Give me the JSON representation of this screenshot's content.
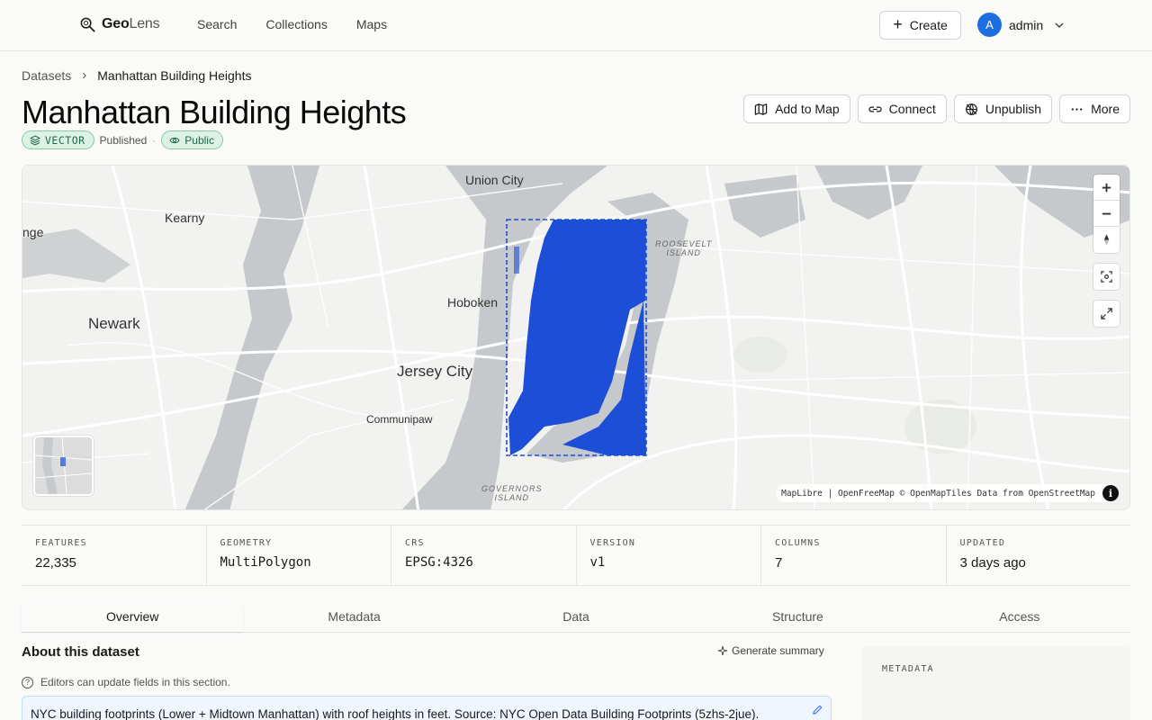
{
  "brand": {
    "name_bold": "Geo",
    "name_light": "Lens"
  },
  "nav": {
    "links": [
      "Search",
      "Collections",
      "Maps"
    ],
    "create_label": "Create",
    "user_initial": "A",
    "user_name": "admin"
  },
  "breadcrumb": {
    "parent": "Datasets",
    "current": "Manhattan Building Heights"
  },
  "dataset": {
    "title": "Manhattan Building Heights",
    "type_badge": "VECTOR",
    "status": "Published",
    "visibility": "Public"
  },
  "actions": {
    "add_to_map": "Add to Map",
    "connect": "Connect",
    "unpublish": "Unpublish",
    "more": "More"
  },
  "map": {
    "labels": {
      "union_city": "Union City",
      "kearny": "Kearny",
      "orange": "nge",
      "newark": "Newark",
      "hoboken": "Hoboken",
      "jersey_city": "Jersey City",
      "communipaw": "Communipaw",
      "roosevelt_1": "ROOSEVELT",
      "roosevelt_2": "ISLAND",
      "governors_1": "GOVERNORS",
      "governors_2": "ISLAND"
    },
    "attribution": "MapLibre | OpenFreeMap © OpenMapTiles Data from OpenStreetMap",
    "layer_color": "#1d4ed8"
  },
  "stats": [
    {
      "label": "FEATURES",
      "value": "22,335"
    },
    {
      "label": "GEOMETRY",
      "value": "MultiPolygon"
    },
    {
      "label": "CRS",
      "value": "EPSG:4326"
    },
    {
      "label": "VERSION",
      "value": "v1"
    },
    {
      "label": "COLUMNS",
      "value": "7"
    },
    {
      "label": "UPDATED",
      "value": "3 days ago"
    }
  ],
  "tabs": [
    "Overview",
    "Metadata",
    "Data",
    "Structure",
    "Access"
  ],
  "about": {
    "title": "About this dataset",
    "generate_summary": "Generate summary",
    "editors_note": "Editors can update fields in this section.",
    "description": "NYC building footprints (Lower + Midtown Manhattan) with roof heights in feet. Source: NYC Open Data Building Footprints (5zhs-2jue)."
  },
  "metadata_panel": {
    "label": "METADATA"
  }
}
